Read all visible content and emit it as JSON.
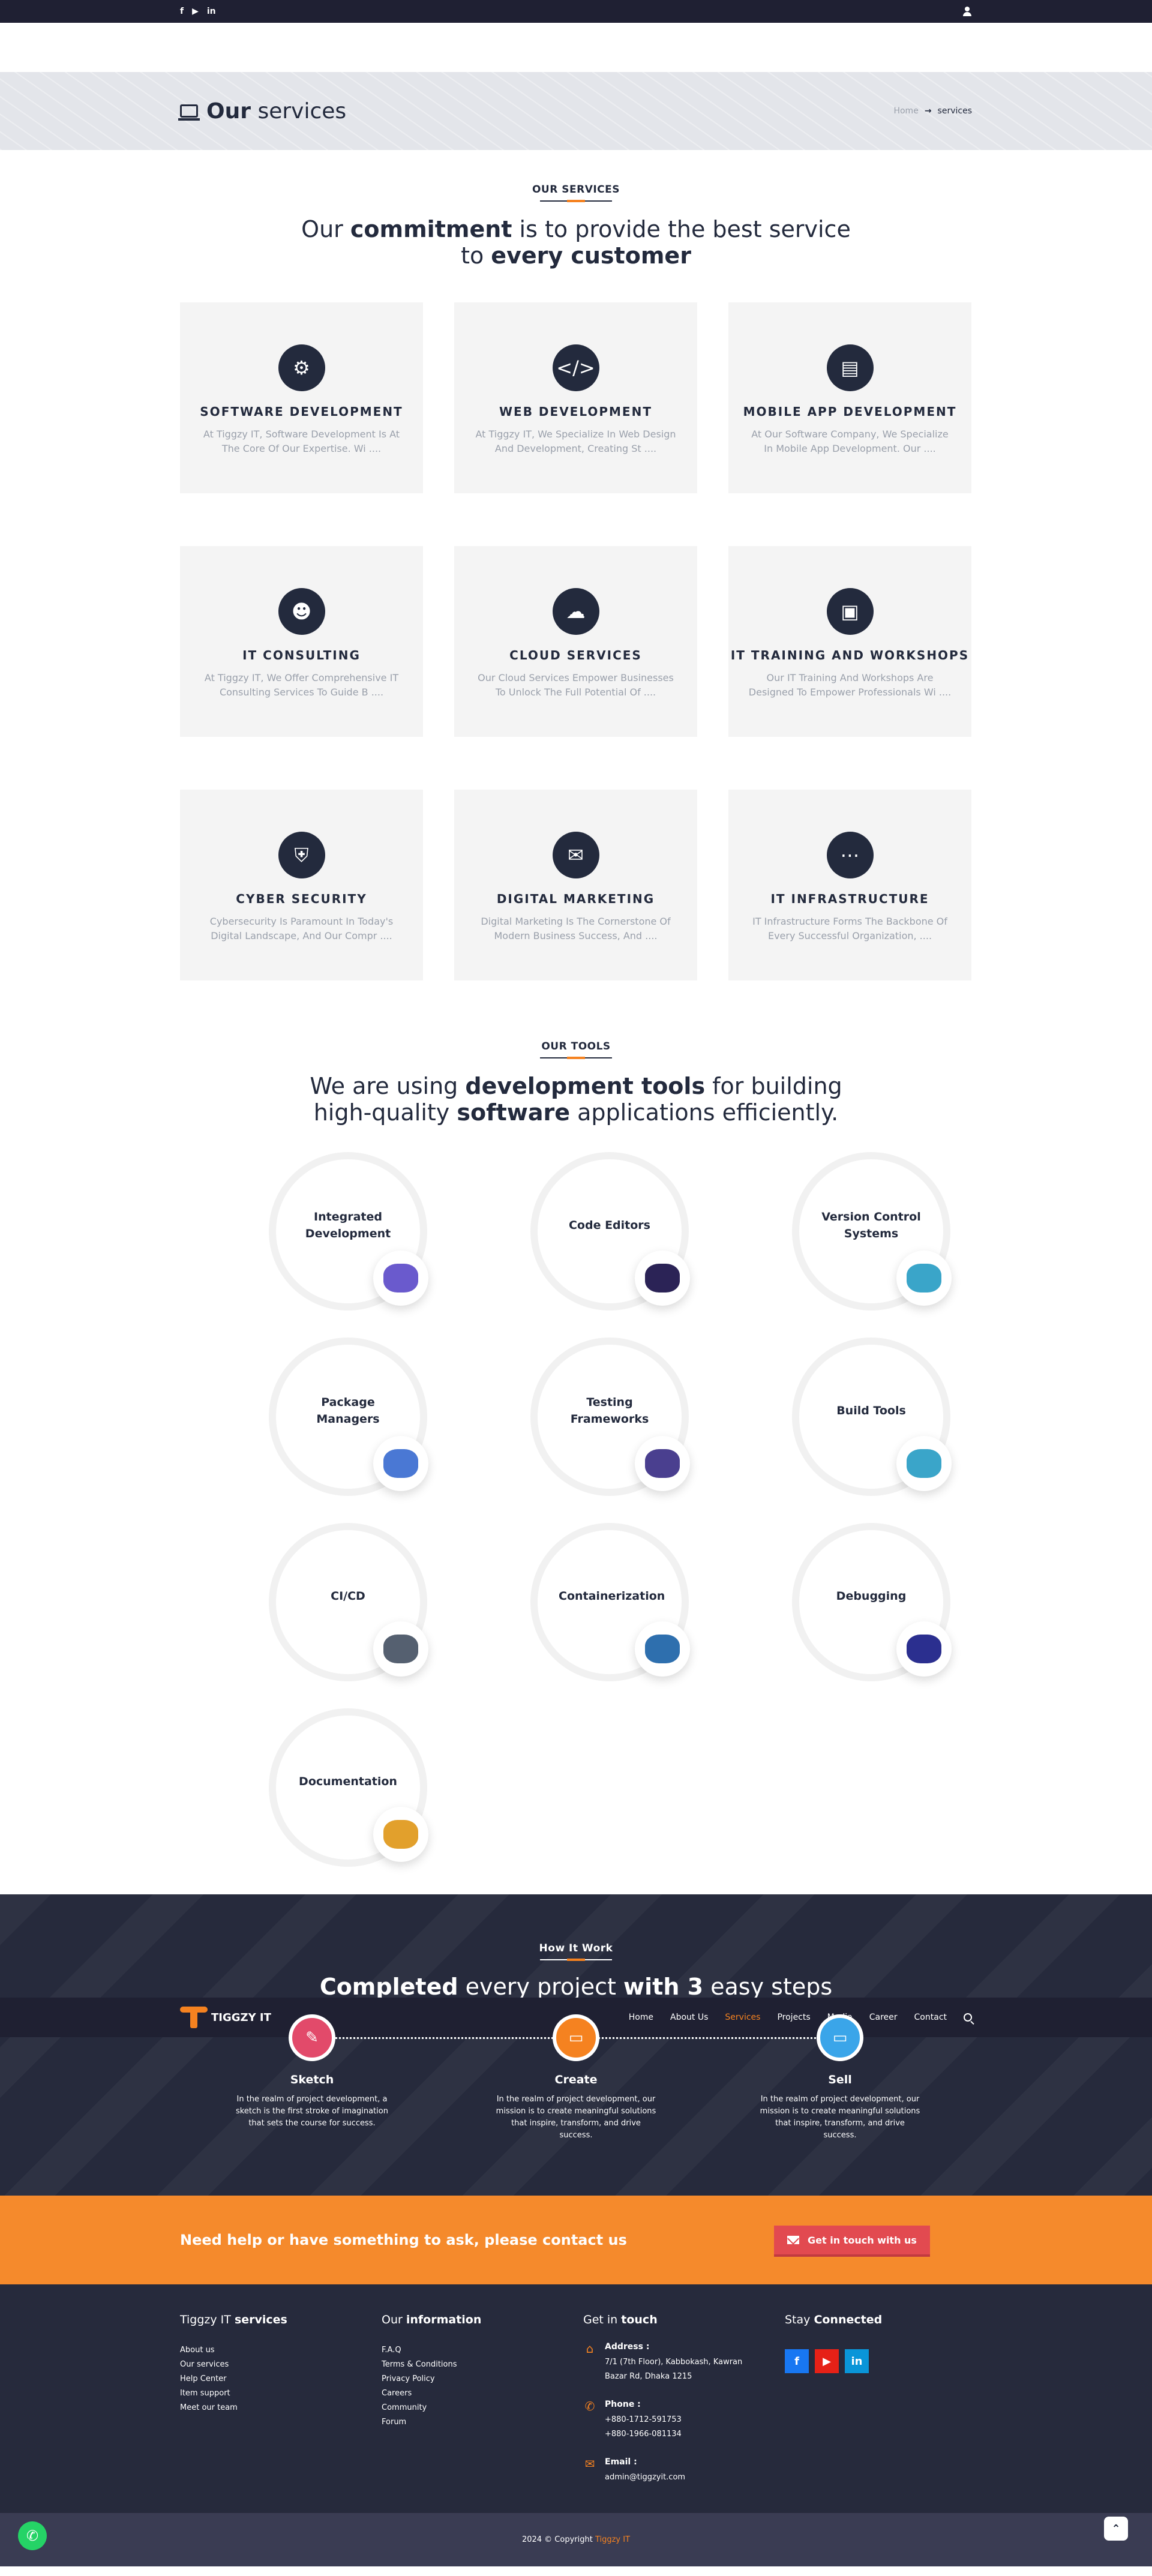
{
  "topbar": {
    "social": [
      "f",
      "▶",
      "in"
    ]
  },
  "page_title": {
    "bold": "Our",
    "rest": " services"
  },
  "breadcrumb": {
    "home": "Home",
    "current": "services"
  },
  "services": {
    "eyebrow": "OUR SERVICES",
    "headline": {
      "a": "Our ",
      "b": "commitment",
      "c": " is to provide the best service",
      "d": "to ",
      "e": "every customer"
    },
    "items": [
      {
        "icon": "laptop-gear-icon",
        "glyph": "⚙",
        "title": "SOFTWARE DEVELOPMENT",
        "desc": "At Tiggzy IT, Software Development Is At The Core Of Our Expertise. Wi ...."
      },
      {
        "icon": "code-monitor-icon",
        "glyph": "</>",
        "title": "WEB DEVELOPMENT",
        "desc": "At Tiggzy IT, We Specialize In Web Design And Development, Creating St ...."
      },
      {
        "icon": "mobile-app-icon",
        "glyph": "▤",
        "title": "MOBILE APP DEVELOPMENT",
        "desc": "At Our Software Company, We Specialize In Mobile App Development. Our ...."
      },
      {
        "icon": "people-icon",
        "glyph": "☻",
        "title": "IT CONSULTING",
        "desc": "At Tiggzy IT, We Offer Comprehensive IT Consulting Services To Guide B ...."
      },
      {
        "icon": "cloud-server-icon",
        "glyph": "☁",
        "title": "CLOUD SERVICES",
        "desc": "Our Cloud Services Empower Businesses To Unlock The Full Potential Of ...."
      },
      {
        "icon": "presentation-board-icon",
        "glyph": "▣",
        "title": "IT TRAINING AND WORKSHOPS",
        "desc": "Our IT Training And Workshops Are Designed To Empower Professionals Wi ...."
      },
      {
        "icon": "shield-lock-icon",
        "glyph": "⛨",
        "title": "CYBER SECURITY",
        "desc": "Cybersecurity Is Paramount In Today's Digital Landscape, And Our Compr ...."
      },
      {
        "icon": "megaphone-icon",
        "glyph": "✉",
        "title": "DIGITAL MARKETING",
        "desc": "Digital Marketing Is The Cornerstone Of Modern Business Success, And ...."
      },
      {
        "icon": "network-nodes-icon",
        "glyph": "⋯",
        "title": "IT INFRASTRUCTURE",
        "desc": "IT Infrastructure Forms The Backbone Of Every Successful Organization, ...."
      }
    ]
  },
  "tools": {
    "eyebrow": "OUR TOOLS",
    "headline": {
      "a": "We are using ",
      "b": "development tools",
      "c": " for building",
      "d": "high-quality ",
      "e": "software",
      "f": " applications efficiently."
    },
    "items": [
      {
        "name": "Integrated Development",
        "icon": "ide-diagram-icon",
        "color": "#6a5acd"
      },
      {
        "name": "Code Editors",
        "icon": "visual-studio-icon",
        "color": "#2b2356"
      },
      {
        "name": "Version Control Systems",
        "icon": "git-branches-icon",
        "color": "#3aa5c9"
      },
      {
        "name": "Package Managers",
        "icon": "snowflake-icon",
        "color": "#4a78d4"
      },
      {
        "name": "Testing Frameworks",
        "icon": "molecule-icon",
        "color": "#4a3f8f"
      },
      {
        "name": "Build Tools",
        "icon": "infinity-icon",
        "color": "#3aa5c9"
      },
      {
        "name": "CI/CD",
        "icon": "pipeline-icon",
        "color": "#556070"
      },
      {
        "name": "Containerization",
        "icon": "container-sphere-icon",
        "color": "#2e6fae"
      },
      {
        "name": "Debugging",
        "icon": "debug-bug-icon",
        "color": "#2b2f8f"
      },
      {
        "name": "Documentation",
        "icon": "documentation-wheel-icon",
        "color": "#e2a02c"
      }
    ]
  },
  "how": {
    "eyebrow": "How It Work",
    "headline": {
      "a": "Completed",
      "b": " every project ",
      "c": "with 3",
      "d": " easy steps"
    },
    "steps": [
      {
        "title": "Sketch",
        "desc": "In the realm of project development, a sketch is the first stroke of imagination that sets the course for success.",
        "color": "#e24a6a",
        "icon": "pencil-icon",
        "glyph": "✎"
      },
      {
        "title": "Create",
        "desc": "In the realm of project development, our mission is to create meaningful solutions that inspire, transform, and drive success.",
        "color": "#f58220",
        "icon": "toolbox-icon",
        "glyph": "▭"
      },
      {
        "title": "Sell",
        "desc": "In the realm of project development, our mission is to create meaningful solutions that inspire, transform, and drive success.",
        "color": "#3aa5e9",
        "icon": "monitor-icon",
        "glyph": "▭"
      }
    ]
  },
  "nav": {
    "logo": "TIGGZY IT",
    "links": [
      "Home",
      "About Us",
      "Services",
      "Projects",
      "Media",
      "Career",
      "Contact"
    ],
    "active": "Services"
  },
  "cta": {
    "text": "Need help or have something to ask, please contact us",
    "button": "Get in touch with us"
  },
  "footer": {
    "col1": {
      "head_a": "Tiggzy IT ",
      "head_b": "services",
      "links": [
        "About us",
        "Our services",
        "Help Center",
        "Item support",
        "Meet our team"
      ]
    },
    "col2": {
      "head_a": "Our ",
      "head_b": "information",
      "links": [
        "F.A.Q",
        "Terms & Conditions",
        "Privacy Policy",
        "Careers",
        "Community",
        "Forum"
      ]
    },
    "col3": {
      "head_a": "Get in ",
      "head_b": "touch",
      "address_label": "Address :",
      "address": "7/1 (7th Floor), Kabbokash, Kawran Bazar Rd, Dhaka 1215",
      "phone_label": "Phone :",
      "phone1": "+880-1712-591753",
      "phone2": "+880-1966-081134",
      "email_label": "Email :",
      "email": "admin@tiggzyit.com"
    },
    "col4": {
      "head_a": "Stay ",
      "head_b": "Connected",
      "social": [
        {
          "label": "f",
          "color": "#1877f2",
          "icon": "facebook-icon"
        },
        {
          "label": "▶",
          "color": "#e62117",
          "icon": "youtube-icon"
        },
        {
          "label": "in",
          "color": "#0a95d8",
          "icon": "linkedin-icon"
        }
      ]
    }
  },
  "copyright": {
    "text": "2024 © Copyright ",
    "brand": "Tiggzy IT"
  }
}
